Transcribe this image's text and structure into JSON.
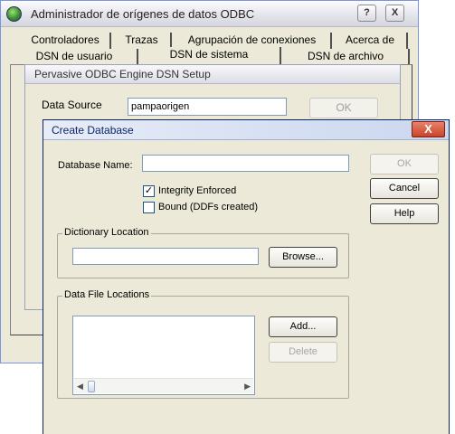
{
  "odbc_admin": {
    "title": "Administrador de orígenes de datos ODBC",
    "help_button": "?",
    "close_button": "X",
    "tabs_row1": [
      "Controladores",
      "Trazas",
      "Agrupación de conexiones",
      "Acerca de"
    ],
    "tabs_row2": [
      "DSN de usuario",
      "DSN de sistema",
      "DSN de archivo"
    ],
    "active_tab": "DSN de sistema"
  },
  "dsn_setup": {
    "title": "Pervasive ODBC Engine DSN Setup",
    "data_source_label": "Data Source",
    "data_source_value": "pampaorigen",
    "ok_label": "OK"
  },
  "create_db": {
    "title": "Create Database",
    "close_glyph": "X",
    "database_name_label": "Database Name:",
    "database_name_value": "",
    "integrity_label": "Integrity Enforced",
    "integrity_checked": true,
    "bound_label": "Bound (DDFs created)",
    "bound_checked": false,
    "dictionary_group": "Dictionary Location",
    "dictionary_value": "",
    "browse_label": "Browse...",
    "datafile_group": "Data File Locations",
    "add_label": "Add...",
    "delete_label": "Delete",
    "ok_label": "OK",
    "cancel_label": "Cancel",
    "help_label": "Help"
  },
  "icons": {
    "checkmark": "✓",
    "scroll_left": "◀",
    "scroll_right": "▶"
  }
}
